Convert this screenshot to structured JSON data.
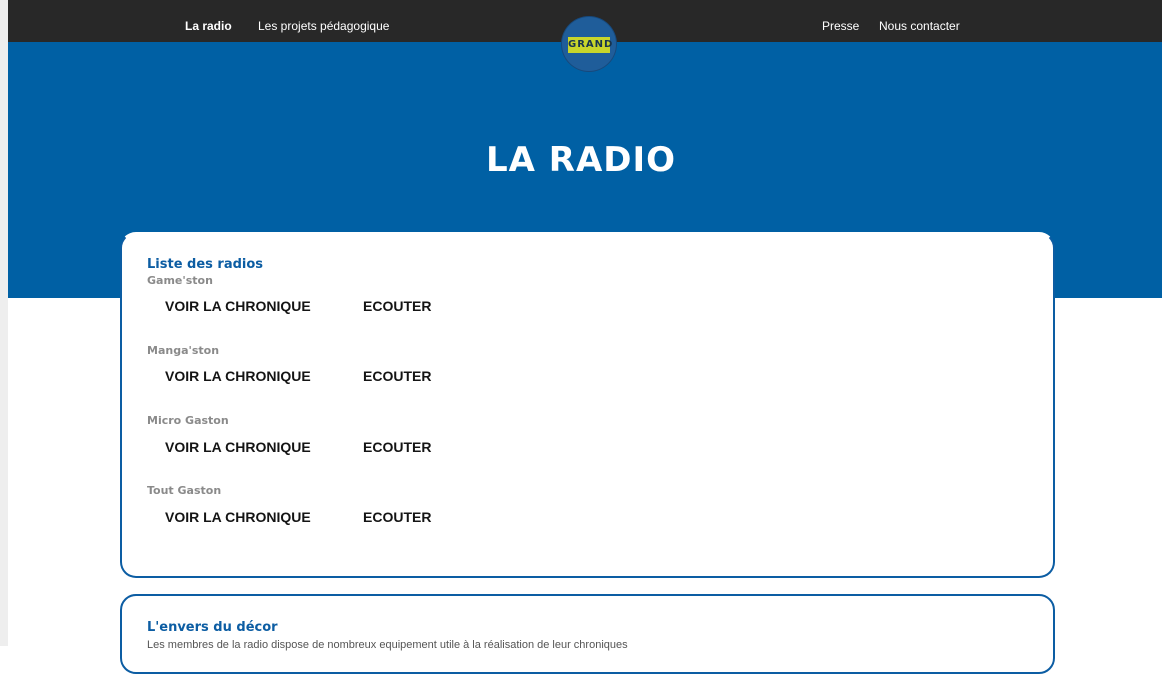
{
  "nav": {
    "left_links": [
      "La radio",
      "Les projets pédagogique"
    ],
    "right_links": [
      "Presse",
      "Nous contacter"
    ],
    "logo_text": "GRAND"
  },
  "hero": {
    "title": "LA RADIO"
  },
  "radios_section": {
    "heading": "Liste des radios",
    "items": [
      {
        "name": "Game'ston",
        "chronicle_label": "VOIR LA CHRONIQUE",
        "listen_label": "ECOUTER"
      },
      {
        "name": "Manga'ston",
        "chronicle_label": "VOIR LA CHRONIQUE",
        "listen_label": "ECOUTER"
      },
      {
        "name": "Micro Gaston",
        "chronicle_label": "VOIR LA CHRONIQUE",
        "listen_label": "ECOUTER"
      },
      {
        "name": "Tout Gaston",
        "chronicle_label": "VOIR LA CHRONIQUE",
        "listen_label": "ECOUTER"
      }
    ]
  },
  "decor_section": {
    "heading": "L'envers du décor",
    "text": "Les membres de la radio dispose de nombreux equipement utile à la réalisation de leur chroniques"
  },
  "colors": {
    "topbar": "#282828",
    "hero_blue": "#0060a4",
    "heading_blue": "#0c5da3",
    "logo_yellow": "#c8d52a"
  }
}
